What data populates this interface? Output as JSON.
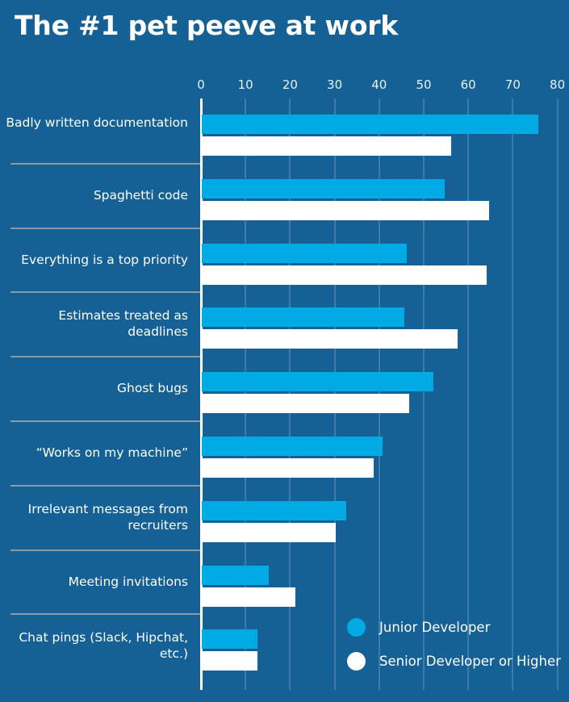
{
  "title": "The #1 pet peeve at work",
  "legend": {
    "items": [
      {
        "label": "Junior Developer",
        "color": "#00abe3",
        "marker": "circle-filled-cyan-icon"
      },
      {
        "label": "Senior Developer or Higher",
        "color": "#ffffff",
        "marker": "circle-filled-white-icon"
      }
    ]
  },
  "colors": {
    "background": "#156195",
    "gridline": "#3b7cab",
    "axis": "#ffffff",
    "separator": "#8b9aa3",
    "junior": "#00abe3",
    "senior": "#ffffff",
    "text": "#ffffff"
  },
  "chart_data": {
    "type": "bar",
    "orientation": "horizontal",
    "title": "The #1 pet peeve at work",
    "xlabel": "",
    "ylabel": "",
    "xlim": [
      0,
      80
    ],
    "xticks": [
      0,
      10,
      20,
      30,
      40,
      50,
      60,
      70,
      80
    ],
    "tick_labels": [
      "0",
      "10",
      "20",
      "30",
      "40",
      "50",
      "60",
      "70",
      "80"
    ],
    "grid": true,
    "legend_position": "bottom-right",
    "categories": [
      "Badly written documentation",
      "Spaghetti code",
      "Everything is a top priority",
      "Estimates treated as deadlines",
      "Ghost bugs",
      "“Works on my machine”",
      "Irrelevant messages from recruiters",
      "Meeting invitations",
      "Chat pings (Slack, Hipchat, etc.)"
    ],
    "series": [
      {
        "name": "Junior Developer",
        "color": "#00abe3",
        "values": [
          75.5,
          54.5,
          46,
          45.5,
          52,
          40.5,
          32.5,
          15,
          12.5
        ]
      },
      {
        "name": "Senior Developer or Higher",
        "color": "#ffffff",
        "values": [
          56,
          64.5,
          64,
          57.5,
          46.5,
          38.5,
          30,
          21,
          12.5
        ]
      }
    ]
  }
}
